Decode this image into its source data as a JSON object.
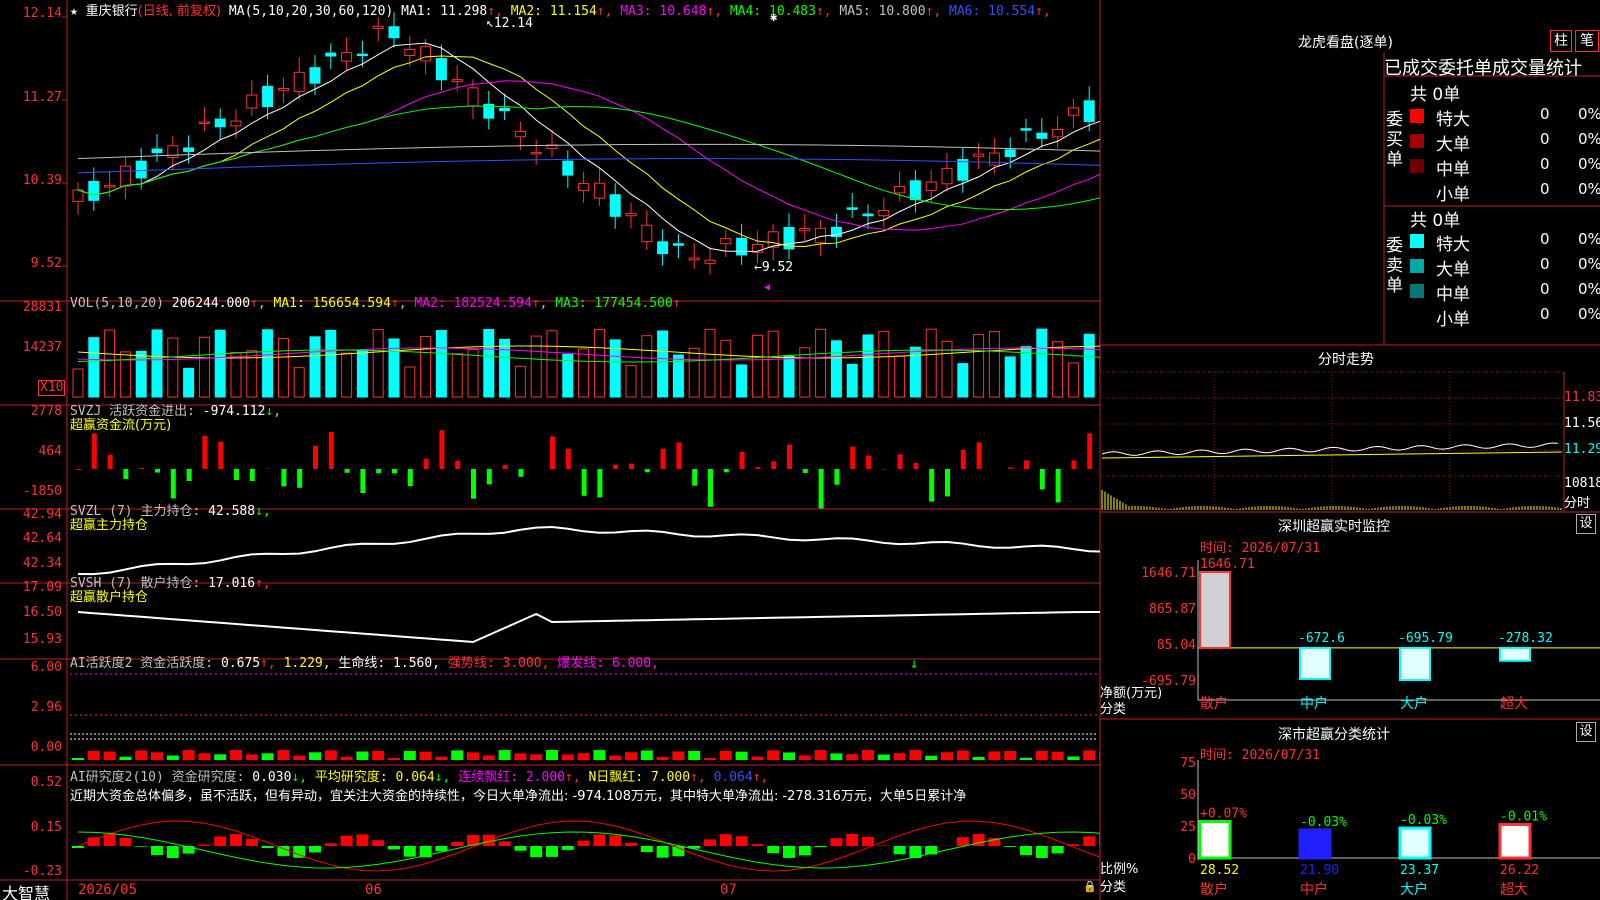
{
  "kline": {
    "stock_name": "重庆银行",
    "period_label": "(日线, 前复权)",
    "ma_params": "MA(5,10,20,30,60,120)",
    "ma": [
      {
        "label": "MA1:",
        "value": "11.298",
        "arrow": "↑",
        "color": "#ffffff"
      },
      {
        "label": "MA2:",
        "value": "11.154",
        "arrow": "↑",
        "color": "#ffff00"
      },
      {
        "label": "MA3:",
        "value": "10.648",
        "arrow": "↑",
        "color": "#ff00ff"
      },
      {
        "label": "MA4:",
        "value": "10.483",
        "arrow": "↑",
        "color": "#00ff00"
      },
      {
        "label": "MA5:",
        "value": "10.800",
        "arrow": "↑",
        "color": "#c0c0c0"
      },
      {
        "label": "MA6:",
        "value": "10.554",
        "arrow": "↑",
        "color": "#3050ff"
      }
    ],
    "high_label": "12.14",
    "low_label": "9.52",
    "y_ticks": [
      "12.14",
      "11.27",
      "10.39",
      "9.52"
    ]
  },
  "vol": {
    "header": "VOL(5,10,20)",
    "value": "206244.000",
    "arrow": "↑",
    "ma1": "MA1: 156654.594",
    "ma2": "MA2: 182524.594",
    "ma3": "MA3: 177454.500",
    "y_ticks": [
      "28831",
      "14237"
    ],
    "unit": "X10"
  },
  "svzj": {
    "header": "SVZJ  活跃资金进出:",
    "value": "-974.112",
    "arrow": "↓",
    "subtitle": "超赢资金流(万元)",
    "y_ticks": [
      "2778",
      "464",
      "-1850"
    ]
  },
  "svzl": {
    "header": "SVZL (7) 主力持仓:",
    "value": "42.588",
    "arrow": "↓,",
    "subtitle": "超赢主力持仓",
    "y_ticks": [
      "42.94",
      "42.64",
      "42.34"
    ]
  },
  "svsh": {
    "header": "SVSH (7) 散户持仓:",
    "value": "17.016",
    "arrow": "↑,",
    "subtitle": "超赢散户持仓",
    "y_ticks": [
      "17.09",
      "16.50",
      "15.93"
    ]
  },
  "ai1": {
    "header": "AI活跃度2 资金活跃度:",
    "v1": "0.675",
    "a1": "↑,",
    "v2": "1.229,",
    "life": "生命线: 1.560,",
    "strong": "强势线: 3.000,",
    "burst": "爆发线: 6.000,",
    "y_ticks": [
      "6.00",
      "2.96",
      "0.00"
    ]
  },
  "ai2": {
    "header": "AI研究度2(10) 资金研究度:",
    "v1": "0.030",
    "a1": "↓,",
    "avg": "平均研究度: 0.064",
    "avg_a": "↓,",
    "cont": "连续飘红: 2.000",
    "cont_a": "↑,",
    "n": "N日飘红: 7.000",
    "n_a": "↑,",
    "last": "0.064",
    "last_a": "↑,",
    "comment": "近期大资金总体偏多，虽不活跃，但有异动，宜关注大资金的持续性，今日大单净流出: -974.108万元，其中特大单净流出: -278.316万元，大单5日累计净",
    "y_ticks": [
      "0.52",
      "0.15",
      "-0.23"
    ]
  },
  "x_axis": {
    "brand": "大智慧",
    "labels": [
      "2026/05",
      "06",
      "07"
    ]
  },
  "dragon": {
    "title": "龙虎看盘(逐单)",
    "btn1": "柱",
    "btn2": "笔",
    "stat_title": "已成交委托单成交量统计",
    "buy": {
      "side": "委买单",
      "total": "共 0单",
      "rows": [
        {
          "name": "特大",
          "count": "0",
          "pct": "0%",
          "color": "#ff0000"
        },
        {
          "name": "大单",
          "count": "0",
          "pct": "0%",
          "color": "#a00000"
        },
        {
          "name": "中单",
          "count": "0",
          "pct": "0%",
          "color": "#700000"
        },
        {
          "name": "小单",
          "count": "0",
          "pct": "0%",
          "color": "#000000"
        }
      ]
    },
    "sell": {
      "side": "委卖单",
      "total": "共 0单",
      "rows": [
        {
          "name": "特大",
          "count": "0",
          "pct": "0%",
          "color": "#00ffff"
        },
        {
          "name": "大单",
          "count": "0",
          "pct": "0%",
          "color": "#00a8a8"
        },
        {
          "name": "中单",
          "count": "0",
          "pct": "0%",
          "color": "#007878"
        },
        {
          "name": "小单",
          "count": "0",
          "pct": "0%",
          "color": "#000000"
        }
      ]
    }
  },
  "intraday": {
    "title": "分时走势",
    "ticks": [
      "11.83",
      "11.56",
      "11.29",
      "10818"
    ],
    "vol_label": "分时"
  },
  "monitor": {
    "title": "深圳超赢实时监控",
    "set": "设",
    "time": "时间: 2026/07/31",
    "ylabel": "净额(万元)",
    "xlabel": "分类",
    "y_ticks": [
      "1646.71",
      "865.87",
      "85.04",
      "-695.79"
    ],
    "chart_data": {
      "type": "bar",
      "categories": [
        "散户",
        "中户",
        "大户",
        "超大"
      ],
      "values": [
        1646.71,
        -672.6,
        -695.79,
        -278.32
      ],
      "value_labels": [
        "1646.71",
        "-672.6",
        "-695.79",
        "-278.32"
      ],
      "ylim": [
        -695.79,
        1646.71
      ],
      "ylabel": "净额(万元)",
      "xlabel": "分类"
    }
  },
  "classify": {
    "title": "深市超赢分类统计",
    "set": "设",
    "time": "时间: 2026/07/31",
    "ylabel": "比例%",
    "xlabel": "分类",
    "y_ticks": [
      "75",
      "50",
      "25",
      "0"
    ],
    "chart_data": {
      "type": "bar",
      "categories": [
        "散户",
        "中户",
        "大户",
        "超大"
      ],
      "values": [
        28.52,
        21.9,
        23.37,
        26.22
      ],
      "changes": [
        "+0.07%",
        "-0.03%",
        "-0.03%",
        "-0.01%"
      ],
      "value_labels": [
        "28.52",
        "21.90",
        "23.37",
        "26.22"
      ],
      "ylim": [
        0,
        75
      ],
      "ylabel": "比例%",
      "xlabel": "分类"
    }
  }
}
